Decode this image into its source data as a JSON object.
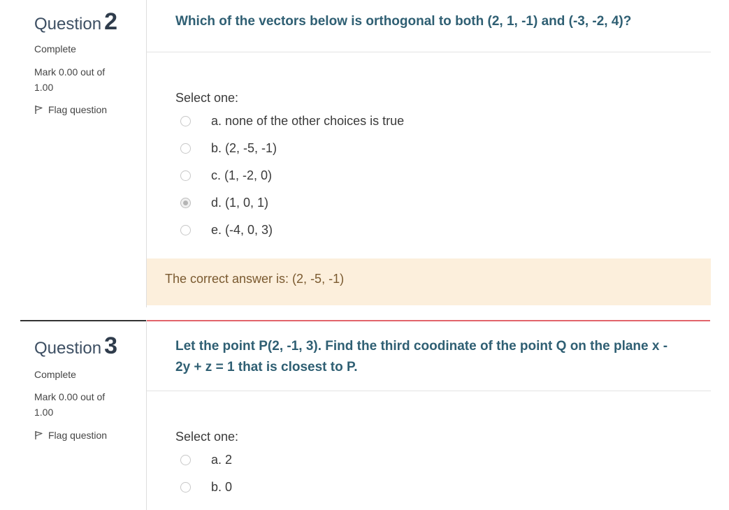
{
  "questions": [
    {
      "heading_word": "Question",
      "number": "2",
      "state": "Complete",
      "grade": "Mark 0.00 out of 1.00",
      "flag_label": "Flag question",
      "text": "Which of the vectors below is orthogonal to both (2, 1, -1) and (-3, -2, 4)?",
      "prompt": "Select one:",
      "answers": [
        {
          "label": "a. none of the other choices is true",
          "selected": false
        },
        {
          "label": "b. (2, -5, -1)",
          "selected": false
        },
        {
          "label": "c. (1, -2, 0)",
          "selected": false
        },
        {
          "label": "d. (1, 0, 1)",
          "selected": true
        },
        {
          "label": "e. (-4, 0, 3)",
          "selected": false
        }
      ],
      "feedback": "The correct answer is: (2, -5, -1)"
    },
    {
      "heading_word": "Question",
      "number": "3",
      "state": "Complete",
      "grade": "Mark 0.00 out of 1.00",
      "flag_label": "Flag question",
      "text": "Let the point P(2, -1, 3). Find the third coodinate of the point Q on the plane x - 2y + z = 1 that is  closest to P.",
      "prompt": "Select one:",
      "answers": [
        {
          "label": "a. 2",
          "selected": false
        },
        {
          "label": "b. 0",
          "selected": false
        }
      ]
    }
  ],
  "colors": {
    "question_text": "#2f5f73",
    "feedback_bg": "#fcefdc",
    "separator_accent": "#e2646a"
  },
  "icons": {
    "flag": "flag-icon",
    "radio": "radio-button"
  }
}
